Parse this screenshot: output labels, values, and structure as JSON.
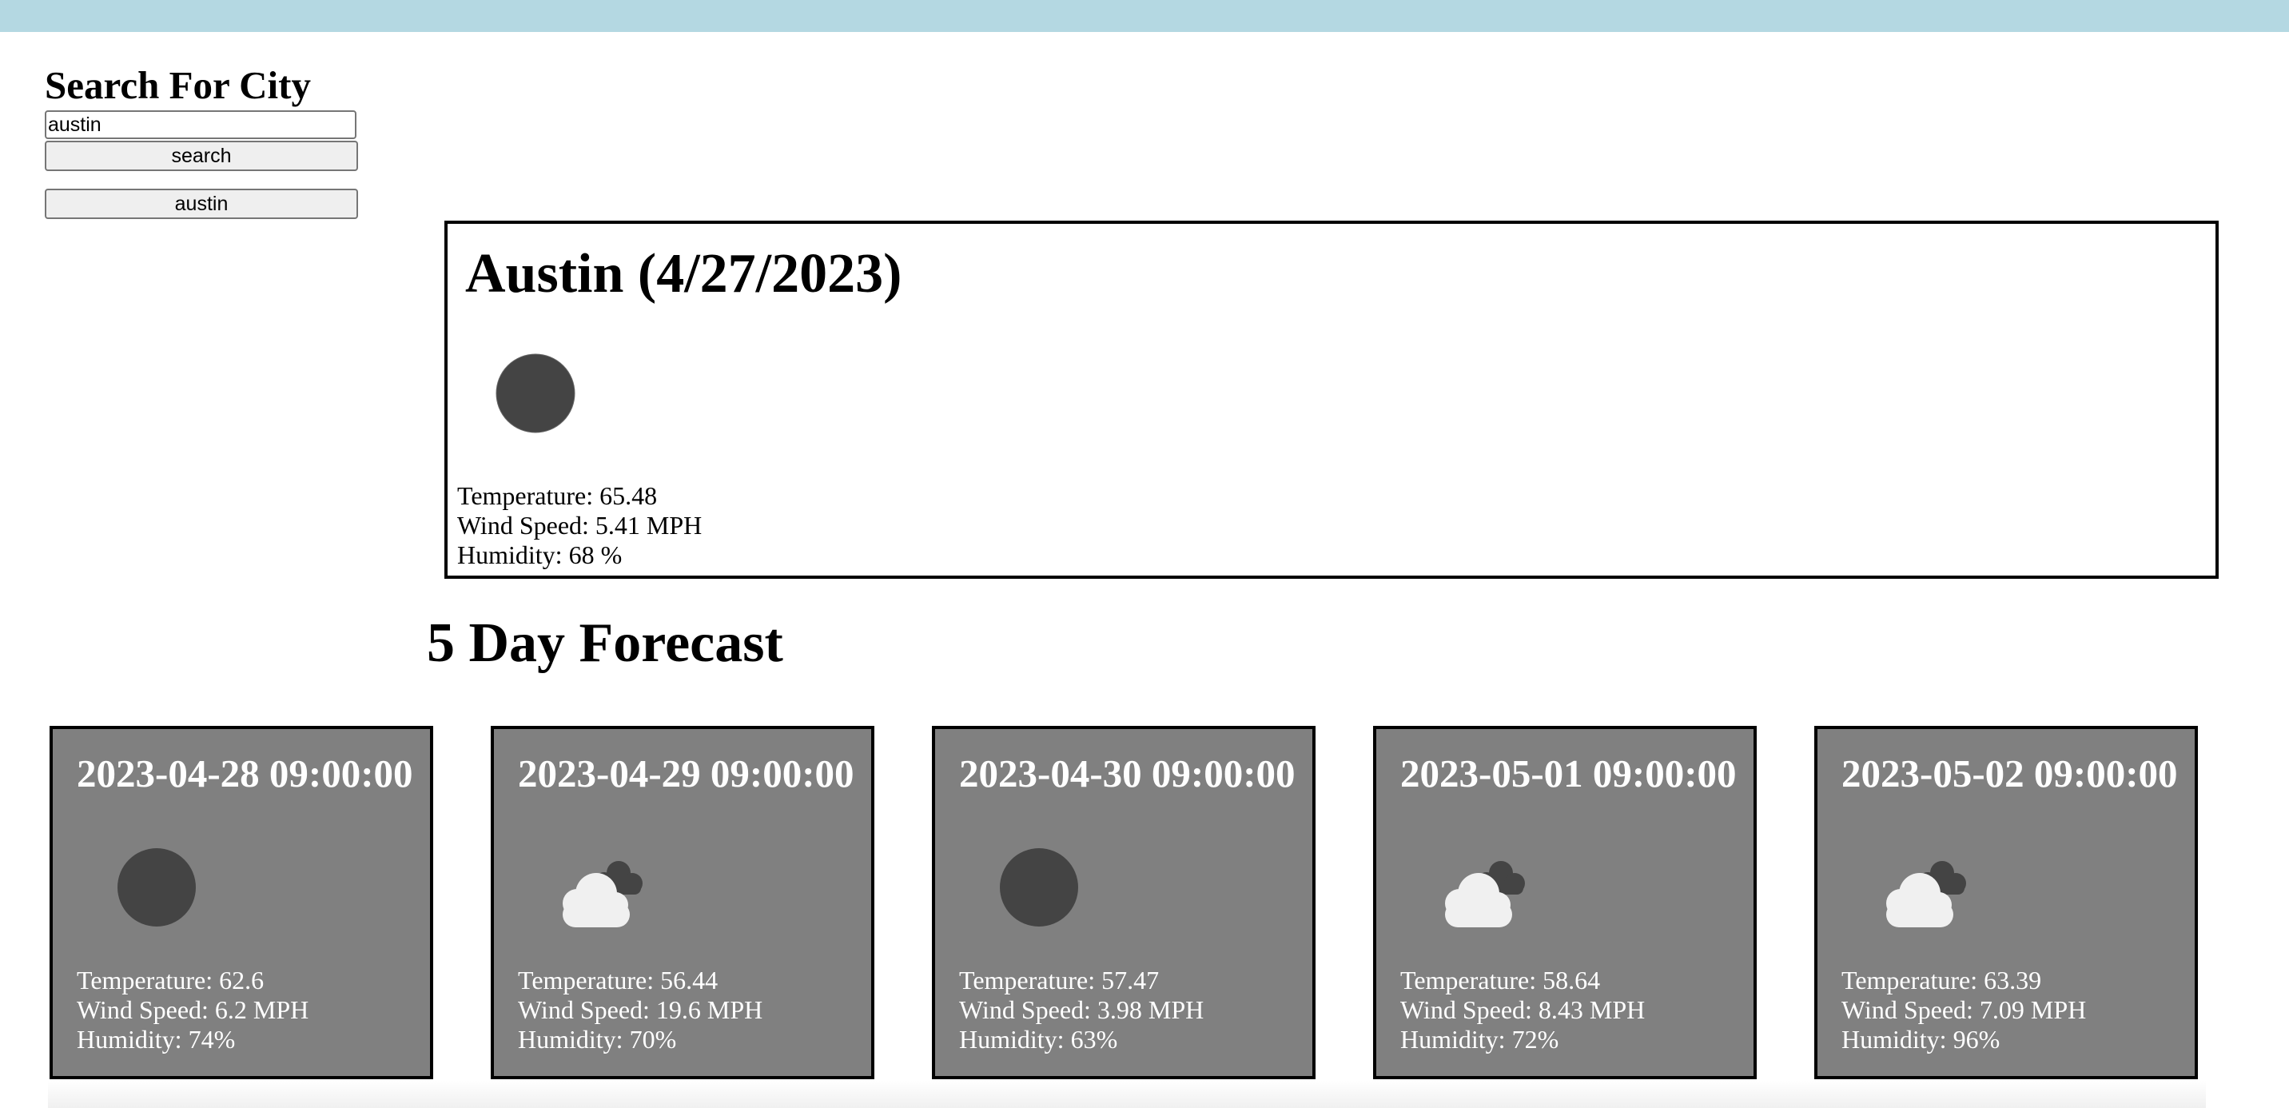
{
  "search": {
    "title": "Search For City",
    "input_value": "austin",
    "button_label": "search",
    "history": [
      "austin"
    ]
  },
  "current": {
    "title": "Austin (4/27/2023)",
    "icon": "moon-icon",
    "temperature": "Temperature: 65.48",
    "wind": "Wind Speed: 5.41 MPH",
    "humidity": "Humidity: 68 %"
  },
  "forecast": {
    "title": "5 Day Forecast",
    "days": [
      {
        "date": "2023-04-28 09:00:00",
        "icon": "moon-icon",
        "temperature": "Temperature: 62.6",
        "wind": "Wind Speed: 6.2 MPH",
        "humidity": "Humidity: 74%"
      },
      {
        "date": "2023-04-29 09:00:00",
        "icon": "cloudy-icon",
        "temperature": "Temperature: 56.44",
        "wind": "Wind Speed: 19.6 MPH",
        "humidity": "Humidity: 70%"
      },
      {
        "date": "2023-04-30 09:00:00",
        "icon": "moon-icon",
        "temperature": "Temperature: 57.47",
        "wind": "Wind Speed: 3.98 MPH",
        "humidity": "Humidity: 63%"
      },
      {
        "date": "2023-05-01 09:00:00",
        "icon": "cloudy-icon",
        "temperature": "Temperature: 58.64",
        "wind": "Wind Speed: 8.43 MPH",
        "humidity": "Humidity: 72%"
      },
      {
        "date": "2023-05-02 09:00:00",
        "icon": "cloudy-icon",
        "temperature": "Temperature: 63.39",
        "wind": "Wind Speed: 7.09 MPH",
        "humidity": "Humidity: 96%"
      }
    ]
  },
  "colors": {
    "top_bar": "#b4d8e2",
    "card_background": "#808080",
    "moon": "#444444",
    "cloud_front": "#f0f0f0",
    "cloud_back": "#444444"
  }
}
